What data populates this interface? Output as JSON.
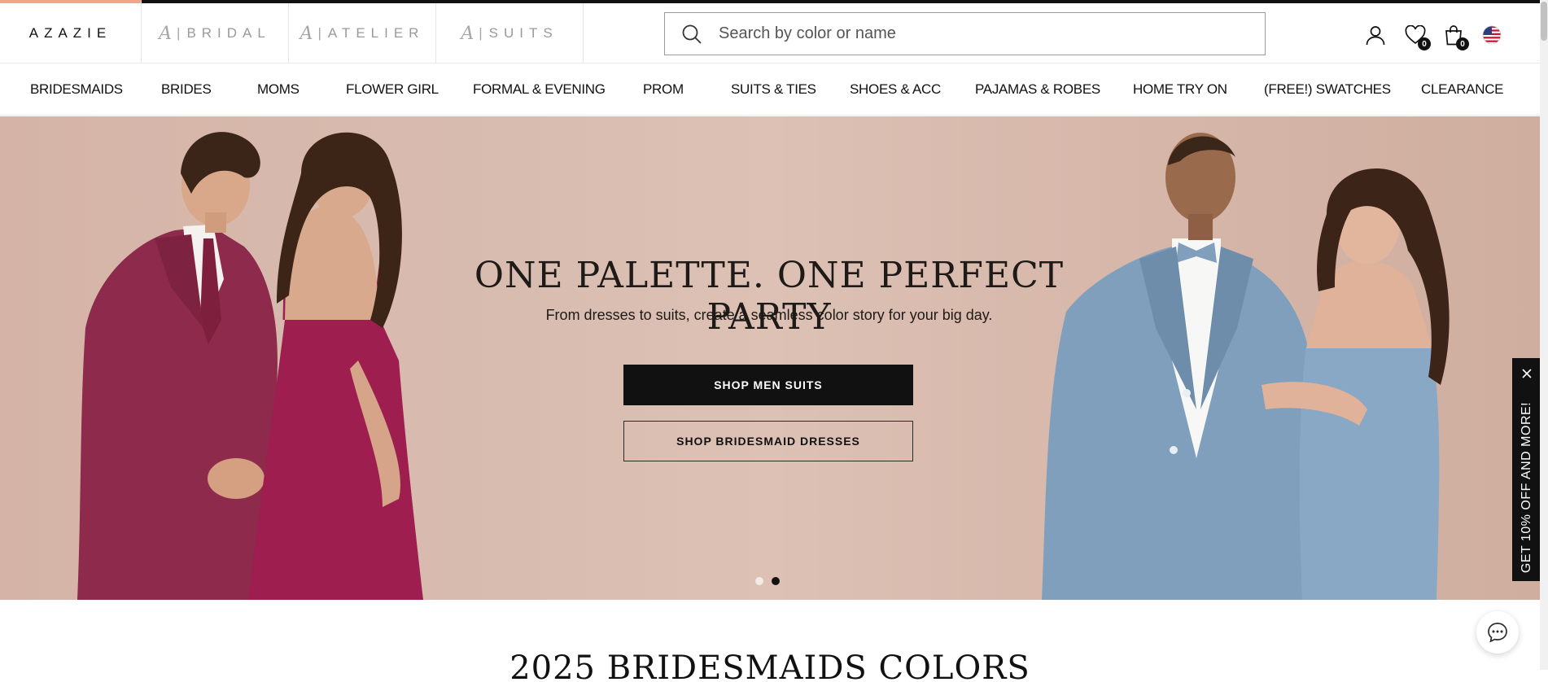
{
  "brand": {
    "logo": "AZAZIE",
    "tabs": [
      {
        "monogram": "A",
        "label": "BRIDAL"
      },
      {
        "monogram": "A",
        "label": "ATELIER"
      },
      {
        "monogram": "A",
        "label": "SUITS"
      }
    ]
  },
  "search": {
    "placeholder": "Search by color or name"
  },
  "header": {
    "wishlist_count": "0",
    "cart_count": "0"
  },
  "nav": {
    "items": [
      "BRIDESMAIDS",
      "BRIDES",
      "MOMS",
      "FLOWER GIRL",
      "FORMAL & EVENING",
      "PROM",
      "SUITS & TIES",
      "SHOES & ACC",
      "PAJAMAS & ROBES",
      "HOME TRY ON",
      "(FREE!) SWATCHES",
      "CLEARANCE"
    ]
  },
  "hero": {
    "title": "ONE PALETTE. ONE PERFECT PARTY",
    "subtitle": "From dresses to suits, create a seamless color story for your big day.",
    "primary_cta": "SHOP MEN SUITS",
    "secondary_cta": "SHOP BRIDESMAID DRESSES",
    "slides_total": 2,
    "active_slide": 2
  },
  "promo": {
    "label": "GET 10% OFF AND MORE!"
  },
  "section": {
    "title": "2025 BRIDESMAIDS COLORS"
  },
  "colors": {
    "suit_left": "#8e2a4b",
    "dress_left": "#9d1e4f",
    "suit_right": "#7f9fbd",
    "dress_right": "#89a8c6",
    "accent": "#f0a58a"
  }
}
